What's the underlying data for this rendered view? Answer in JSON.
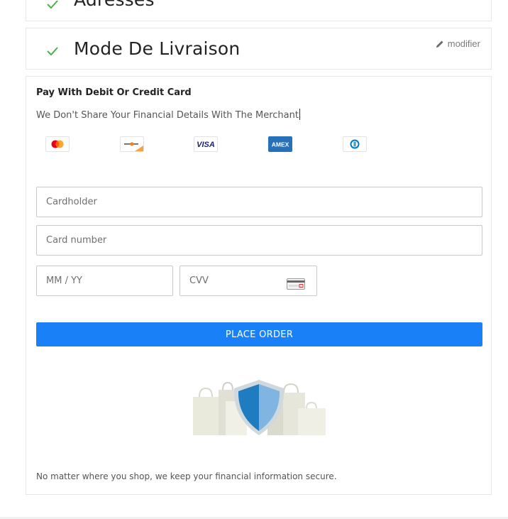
{
  "steps": {
    "adresses": {
      "title": "Adresses",
      "icon": "check-icon"
    },
    "livraison": {
      "title": "Mode De Livraison",
      "edit_label": "modifier",
      "icon": "check-icon"
    }
  },
  "payment": {
    "title": "Pay With Debit Or Credit Card",
    "subtitle": "We Don't Share Your Financial Details With The Merchant",
    "card_logos": [
      {
        "name": "mastercard",
        "icon": "mastercard-icon"
      },
      {
        "name": "discover",
        "icon": "discover-icon"
      },
      {
        "name": "visa",
        "icon": "visa-icon",
        "label": "VISA"
      },
      {
        "name": "amex",
        "icon": "amex-icon",
        "label": "AMEX"
      },
      {
        "name": "diners",
        "icon": "diners-icon"
      }
    ],
    "fields": {
      "cardholder": {
        "placeholder": "Cardholder",
        "value": ""
      },
      "card_number": {
        "placeholder": "Card number",
        "value": ""
      },
      "expiry": {
        "placeholder": "MM / YY",
        "value": ""
      },
      "cvv": {
        "placeholder": "CVV",
        "value": ""
      }
    },
    "submit_label": "PLACE ORDER",
    "secure_message": "No matter where you shop, we keep your financial information secure."
  },
  "colors": {
    "accent": "#1a80f8",
    "check": "#4caf50",
    "border": "#e6e6e6"
  }
}
